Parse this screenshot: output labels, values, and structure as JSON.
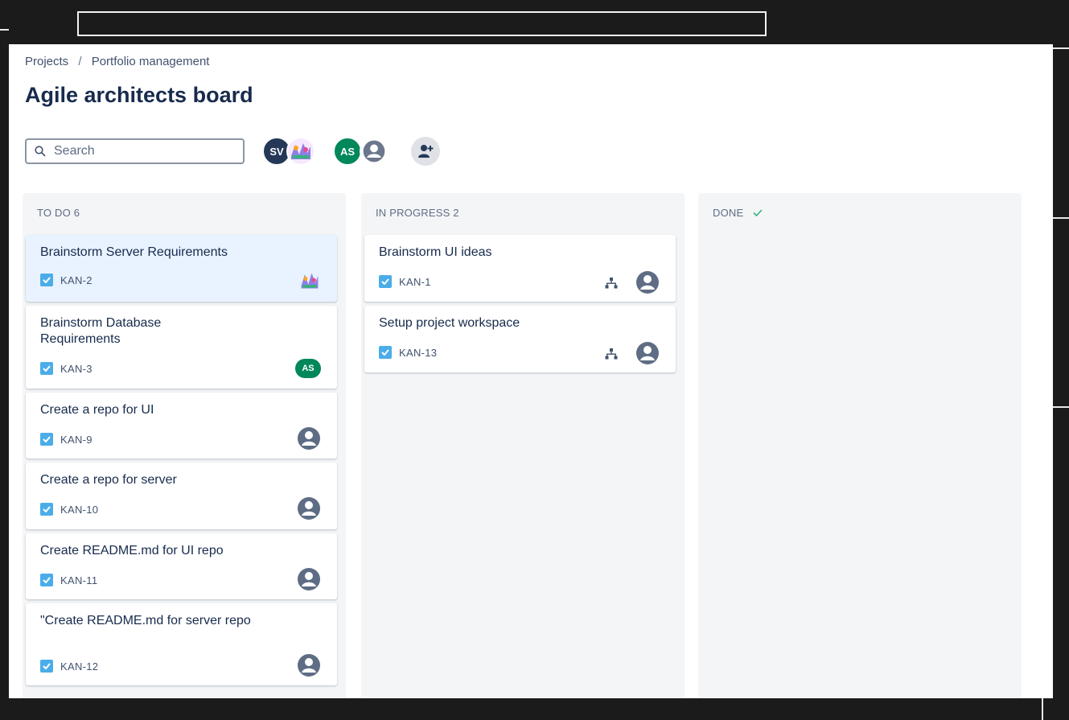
{
  "breadcrumb": {
    "items": [
      "Projects",
      "Portfolio management"
    ],
    "separator": "/"
  },
  "board": {
    "title": "Agile architects board"
  },
  "search": {
    "placeholder": "Search"
  },
  "avatars": [
    {
      "initials": "SV",
      "color": "#253858"
    },
    {
      "initials": "",
      "kind": "image"
    },
    {
      "initials": "AS",
      "color": "#00875a"
    },
    {
      "initials": "",
      "kind": "default-user"
    }
  ],
  "columns": [
    {
      "header": "TO DO 6",
      "cards": [
        {
          "title": "Brainstorm Server Requirements",
          "key": "KAN-2",
          "assignee": "image-avatar",
          "selected": true
        },
        {
          "title": "Brainstorm Database Requirements",
          "key": "KAN-3",
          "assignee": "AS"
        },
        {
          "title": "Create a repo for UI",
          "key": "KAN-9",
          "assignee": "unassigned"
        },
        {
          "title": "Create a repo for server",
          "key": "KAN-10",
          "assignee": "unassigned"
        },
        {
          "title": "Create README.md for UI repo",
          "key": "KAN-11",
          "assignee": "unassigned"
        },
        {
          "title": "\"Create README.md for server repo",
          "key": "KAN-12",
          "assignee": "unassigned"
        }
      ]
    },
    {
      "header": "IN PROGRESS 2",
      "cards": [
        {
          "title": "Brainstorm UI ideas",
          "key": "KAN-1",
          "assignee": "unassigned",
          "icon": "child-issues-icon"
        },
        {
          "title": "Setup project workspace",
          "key": "KAN-13",
          "assignee": "unassigned",
          "icon": "child-issues-icon"
        }
      ]
    },
    {
      "header": "DONE",
      "header_icon": "checkmark-icon",
      "cards": []
    }
  ],
  "colors": {
    "task_icon": "#4bade8",
    "done_check": "#36b37e",
    "selected_card": "#e9f2ff"
  }
}
